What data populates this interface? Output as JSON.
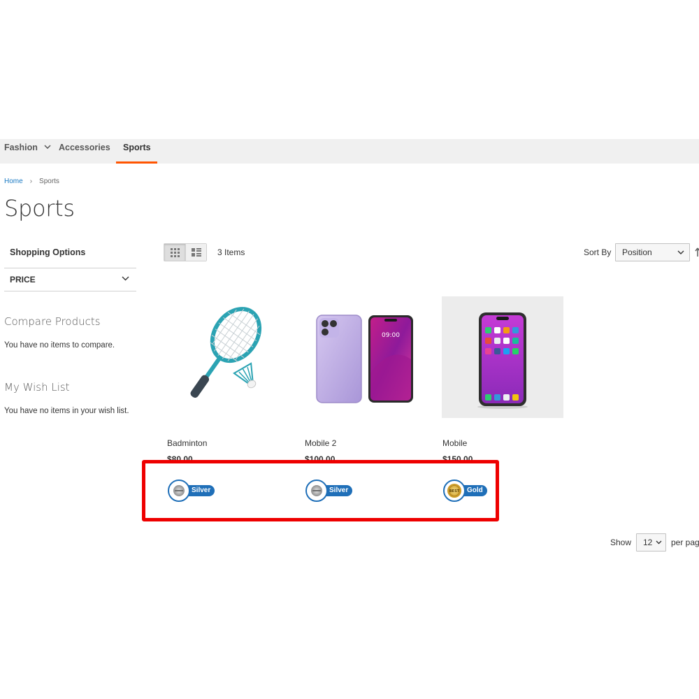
{
  "nav": {
    "items": [
      {
        "label": "Fashion",
        "has_dropdown": true,
        "active": false
      },
      {
        "label": "Accessories",
        "has_dropdown": false,
        "active": false
      },
      {
        "label": "Sports",
        "has_dropdown": false,
        "active": true
      }
    ]
  },
  "breadcrumb": {
    "home": "Home",
    "current": "Sports"
  },
  "page_title": "Sports",
  "sidebar": {
    "shopping_options": "Shopping Options",
    "filter_price": "PRICE",
    "compare_title": "Compare Products",
    "compare_text": "You have no items to compare.",
    "wishlist_title": "My Wish List",
    "wishlist_text": "You have no items in your wish list."
  },
  "toolbar": {
    "amount": "3 Items",
    "sort_label": "Sort By",
    "sort_value": "Position",
    "show_label": "Show",
    "limit_value": "12",
    "per_page": "per page"
  },
  "products": [
    {
      "name": "Badminton",
      "price": "$80.00",
      "badge": "Silver"
    },
    {
      "name": "Mobile 2",
      "price": "$100.00",
      "badge": "Silver"
    },
    {
      "name": "Mobile",
      "price": "$150.00",
      "badge": "Gold"
    }
  ],
  "badge_icon_text": "BEST",
  "colors": {
    "accent": "#ff5501",
    "link": "#1979c3",
    "badge_blue": "#1f6fb8",
    "highlight": "#ee0000"
  }
}
